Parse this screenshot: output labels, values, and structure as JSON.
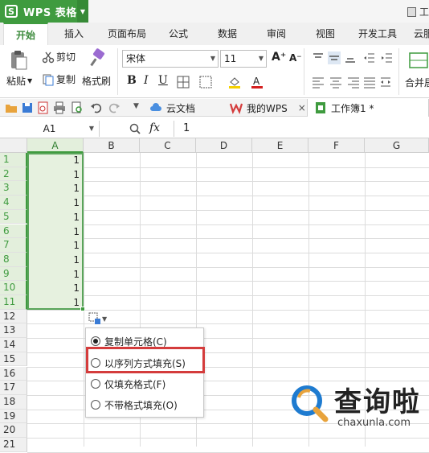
{
  "window": {
    "app_title": "WPS 表格",
    "right_label": "工"
  },
  "ribbon_tabs": [
    "开始",
    "插入",
    "页面布局",
    "公式",
    "数据",
    "审阅",
    "视图",
    "开发工具",
    "云服"
  ],
  "ribbon": {
    "paste_label": "粘贴",
    "cut_label": "剪切",
    "copy_label": "复制",
    "format_painter_label": "格式刷",
    "font_name": "宋体",
    "font_size": "11",
    "merge_label": "合并居"
  },
  "quick_access": {
    "doc_tabs": [
      {
        "label": "云文档"
      },
      {
        "label": "我的WPS"
      },
      {
        "label": "工作簿1 *"
      }
    ]
  },
  "formula_bar": {
    "name_box": "A1",
    "fx_label": "fx",
    "content": "1"
  },
  "grid": {
    "columns": [
      "A",
      "B",
      "C",
      "D",
      "E",
      "F",
      "G"
    ],
    "rows": [
      "1",
      "2",
      "3",
      "4",
      "5",
      "6",
      "7",
      "8",
      "9",
      "10",
      "11",
      "12",
      "13",
      "14",
      "15",
      "16",
      "17",
      "18",
      "19",
      "20",
      "21"
    ],
    "a_values": [
      "1",
      "1",
      "1",
      "1",
      "1",
      "1",
      "1",
      "1",
      "1",
      "1",
      "1"
    ]
  },
  "autofill_menu": {
    "options": [
      {
        "label": "复制单元格(C)",
        "selected": true
      },
      {
        "label": "以序列方式填充(S)",
        "selected": false
      },
      {
        "label": "仅填充格式(F)",
        "selected": false
      },
      {
        "label": "不带格式填充(O)",
        "selected": false
      }
    ]
  },
  "watermark": {
    "text": "查询啦",
    "url": "chaxunla.com"
  },
  "colors": {
    "accent": "#3f9b3f",
    "selection_fill": "#e6f1df",
    "highlight": "#d43c3c"
  }
}
